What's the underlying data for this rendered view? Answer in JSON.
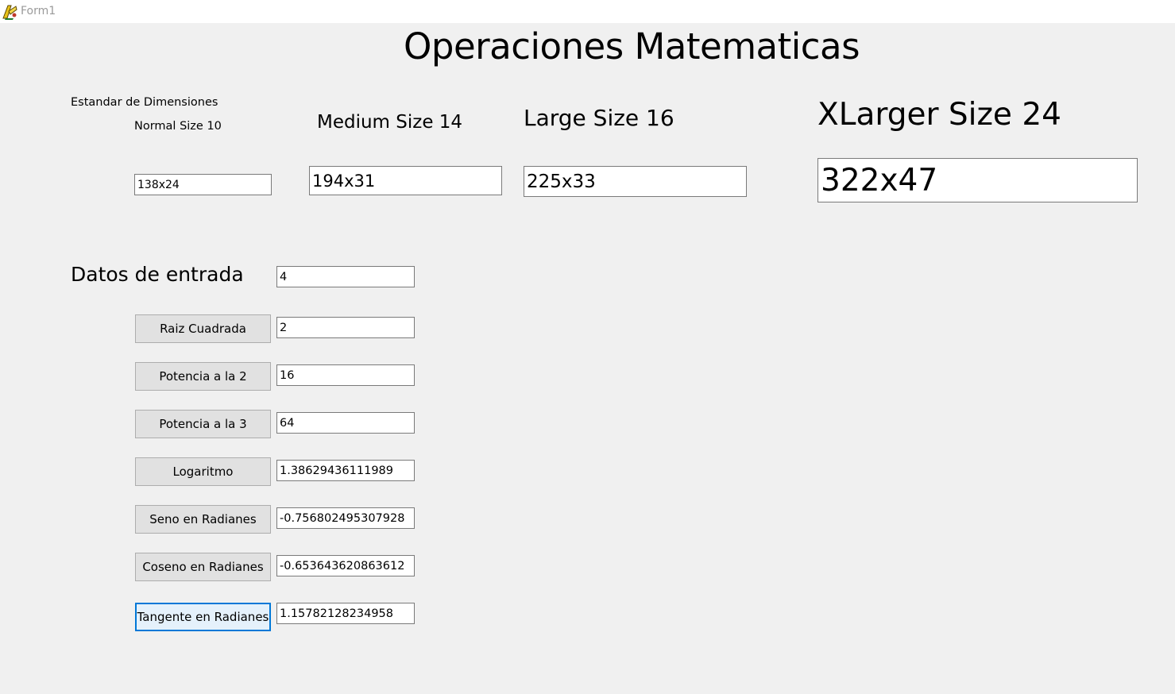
{
  "window": {
    "title": "Form1",
    "icon": "delphi-app-icon"
  },
  "heading": "Operaciones Matematicas",
  "sizes": {
    "standard_label": "Estandar de Dimensiones",
    "normal": {
      "label": "Normal Size 10",
      "value": "138x24"
    },
    "medium": {
      "label": "Medium Size 14",
      "value": "194x31"
    },
    "large": {
      "label": "Large Size 16",
      "value": "225x33"
    },
    "xlarge": {
      "label": "XLarger Size 24",
      "value": "322x47"
    }
  },
  "input": {
    "label": "Datos de entrada",
    "value": "4"
  },
  "operations": [
    {
      "button": "Raiz Cuadrada",
      "result": "2"
    },
    {
      "button": "Potencia a la 2",
      "result": "16"
    },
    {
      "button": "Potencia a la 3",
      "result": "64"
    },
    {
      "button": "Logaritmo",
      "result": "1.38629436111989"
    },
    {
      "button": "Seno en Radianes",
      "result": "-0.756802495307928"
    },
    {
      "button": "Coseno en Radianes",
      "result": "-0.653643620863612"
    },
    {
      "button": "Tangente en Radianes",
      "result": "1.15782128234958"
    }
  ],
  "colors": {
    "background": "#f0f0f0",
    "focus_border": "#0078d7",
    "button_face": "#e1e1e1"
  }
}
